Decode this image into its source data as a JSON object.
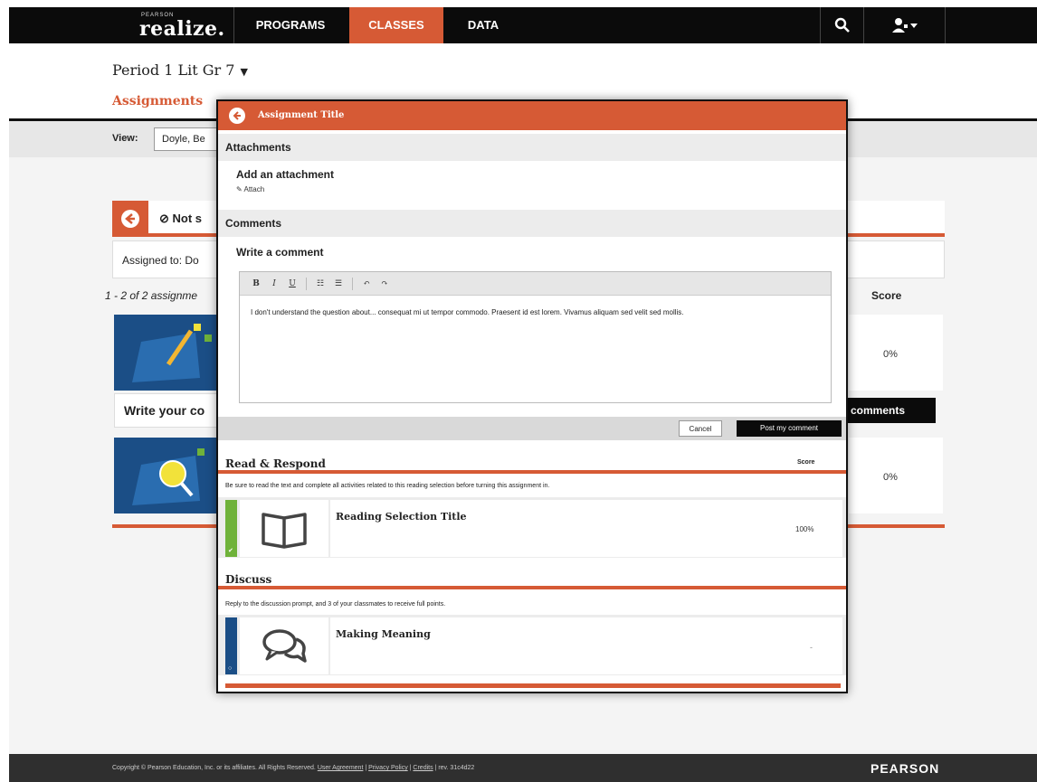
{
  "nav": {
    "brand_small": "PEARSON",
    "brand": "realize.",
    "programs": "PROGRAMS",
    "classes": "CLASSES",
    "data": "DATA"
  },
  "page": {
    "class_title": "Period 1 Lit Gr 7",
    "tab_assignments": "Assignments",
    "view_label": "View:",
    "view_value": "Doyle, Be",
    "status": "Not s",
    "assigned_to": "Assigned to: Do",
    "count": "1 - 2 of 2 assignme",
    "score_header": "Score",
    "score_1": "0%",
    "score_2": "0%",
    "card_label": "Write your co",
    "comments_btn": "comments"
  },
  "modal": {
    "title": "Assignment Title",
    "attachments_header": "Attachments",
    "add_attachment": "Add an attachment",
    "attach_link": "✎ Attach",
    "comments_header": "Comments",
    "write_comment": "Write a comment",
    "toolbar": [
      "B",
      "I",
      "U",
      "☷",
      "☰",
      "↶",
      "↷"
    ],
    "comment_text": "I don't understand the question about... consequat mi ut tempor commodo. Praesent id est lorem. Vivamus aliquam sed velit sed mollis.",
    "cancel": "Cancel",
    "post": "Post my comment",
    "groups": [
      {
        "title": "Read & Respond",
        "score_label": "Score",
        "description": "Be sure to read the text and complete all activities related to this reading selection before turning this assignment in.",
        "item_title": "Reading Selection Title",
        "item_score": "100%",
        "strip_color": "#6fb23a"
      },
      {
        "title": "Discuss",
        "description": "Reply to the discussion prompt, and 3 of your classmates to receive full points.",
        "item_title": "Making Meaning",
        "item_score": "-",
        "strip_color": "#1b4e86"
      }
    ]
  },
  "footer": {
    "copyright": "Copyright © Pearson Education, Inc. or its affiliates. All Rights Reserved.",
    "user_agreement": "User Agreement",
    "privacy": "Privacy Policy",
    "credits": "Credits",
    "rev": "rev. 31c4d22",
    "brand": "PEARSON"
  },
  "colors": {
    "accent": "#d65a35",
    "nav_bg": "#0b0b0b",
    "complete": "#6fb23a",
    "discuss": "#1b4e86"
  }
}
